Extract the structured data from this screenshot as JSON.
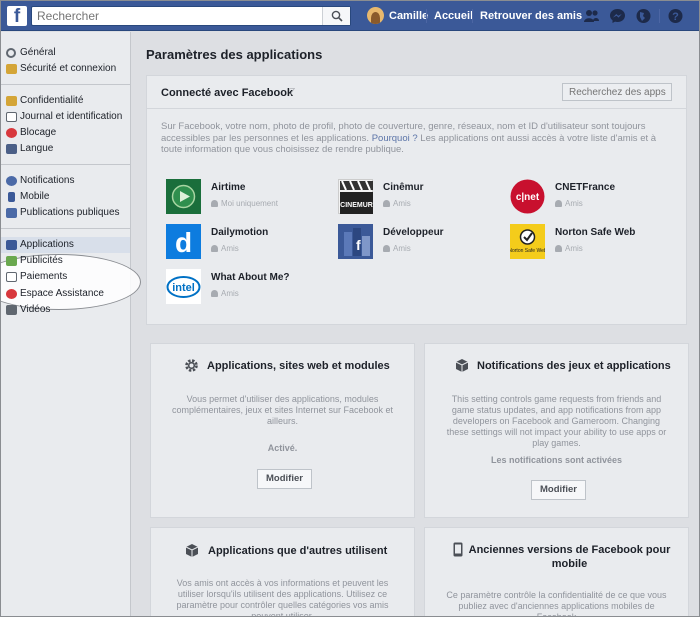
{
  "topbar": {
    "logo": "f",
    "search_placeholder": "Rechercher",
    "user_name": "Camille",
    "home": "Accueil",
    "find_friends": "Retrouver des amis"
  },
  "sidebar": {
    "groups": [
      [
        {
          "label": "Général",
          "icon": "gear-icon"
        },
        {
          "label": "Sécurité et connexion",
          "icon": "badge-icon"
        }
      ],
      [
        {
          "label": "Confidentialité",
          "icon": "lock-icon"
        },
        {
          "label": "Journal et identification",
          "icon": "timeline-icon"
        },
        {
          "label": "Blocage",
          "icon": "block-icon"
        },
        {
          "label": "Langue",
          "icon": "language-icon"
        }
      ],
      [
        {
          "label": "Notifications",
          "icon": "globe-icon"
        },
        {
          "label": "Mobile",
          "icon": "mobile-icon"
        },
        {
          "label": "Publications publiques",
          "icon": "rss-icon"
        }
      ],
      [
        {
          "label": "Applications",
          "icon": "apps-icon"
        },
        {
          "label": "Publicités",
          "icon": "ads-icon"
        },
        {
          "label": "Paiements",
          "icon": "payment-icon"
        },
        {
          "label": "Espace Assistance",
          "icon": "help-icon"
        },
        {
          "label": "Vidéos",
          "icon": "video-icon"
        }
      ]
    ]
  },
  "main": {
    "title": "Paramètres des applications",
    "connected": {
      "title": "Connecté avec Facebook",
      "count": "7",
      "search_placeholder": "Recherchez des apps",
      "desc_part1": "Sur Facebook, votre nom, photo de profil, photo de couverture, genre, réseaux, nom et ID d'utilisateur sont toujours accessibles par les personnes et les applications.",
      "desc_link": "Pourquoi ?",
      "desc_part2": "Les applications ont aussi accès à votre liste d'amis et à toute information que vous choisissez de rendre publique.",
      "apps": [
        {
          "name": "Airtime",
          "privacy": "Moi uniquement"
        },
        {
          "name": "Cinêmur",
          "privacy": "Amis"
        },
        {
          "name": "CNETFrance",
          "privacy": "Amis"
        },
        {
          "name": "Dailymotion",
          "privacy": "Amis"
        },
        {
          "name": "Développeur",
          "privacy": "Amis"
        },
        {
          "name": "Norton Safe Web",
          "privacy": "Amis"
        },
        {
          "name": "What About Me?",
          "privacy": "Amis"
        }
      ]
    },
    "cards": [
      {
        "title": "Applications, sites web et modules",
        "desc": "Vous permet d'utiliser des applications, modules complémentaires, jeux et sites Internet sur Facebook et ailleurs.",
        "status": "Activé.",
        "button": "Modifier"
      },
      {
        "title": "Notifications des jeux et applications",
        "desc": "This setting controls game requests from friends and game status updates, and app notifications from app developers on Facebook and Gameroom. Changing these settings will not impact your ability to use apps or play games.",
        "status": "Les notifications sont activées",
        "button": "Modifier"
      },
      {
        "title": "Applications que d'autres utilisent",
        "desc": "Vos amis ont accès à vos informations et peuvent les utiliser lorsqu'ils utilisent des applications. Utilisez ce paramètre pour contrôler quelles catégories vos amis peuvent utiliser."
      },
      {
        "title": "Anciennes versions de Facebook pour mobile",
        "desc": "Ce paramètre contrôle la confidentialité de ce que vous publiez avec d'anciennes applications mobiles de Facebook"
      }
    ]
  },
  "colors": {
    "brand": "#3b5998",
    "background": "#e9ebee"
  }
}
